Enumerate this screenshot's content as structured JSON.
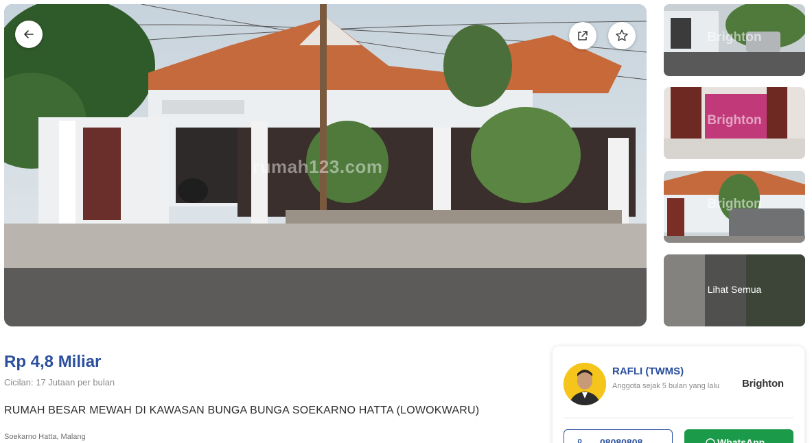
{
  "gallery": {
    "watermark": "rumah123.com",
    "thumbnails": [
      {
        "watermark": "Brighton"
      },
      {
        "watermark": "Brighton"
      },
      {
        "watermark": "Brighton"
      },
      {
        "label": "Lihat Semua"
      }
    ],
    "icons": {
      "back": "arrow-left-icon",
      "share": "share-icon",
      "favorite": "star-icon"
    }
  },
  "listing": {
    "price": "Rp 4,8 Miliar",
    "installment": "Cicilan: 17 Jutaan per bulan",
    "title": "RUMAH BESAR MEWAH DI KAWASAN BUNGA BUNGA SOEKARNO HATTA (LOWOKWARU)",
    "location": "Soekarno Hatta, Malang"
  },
  "agent": {
    "name": "RAFLI (TWMS)",
    "member_since": "Anggota sejak 5 bulan yang lalu",
    "agency": "Brighton",
    "phone_label": "08080808",
    "whatsapp_label": "WhatsApp"
  },
  "colors": {
    "accent": "#2a4f9d",
    "whatsapp": "#1b9a4a",
    "agency_brand": "#f2b90f"
  }
}
